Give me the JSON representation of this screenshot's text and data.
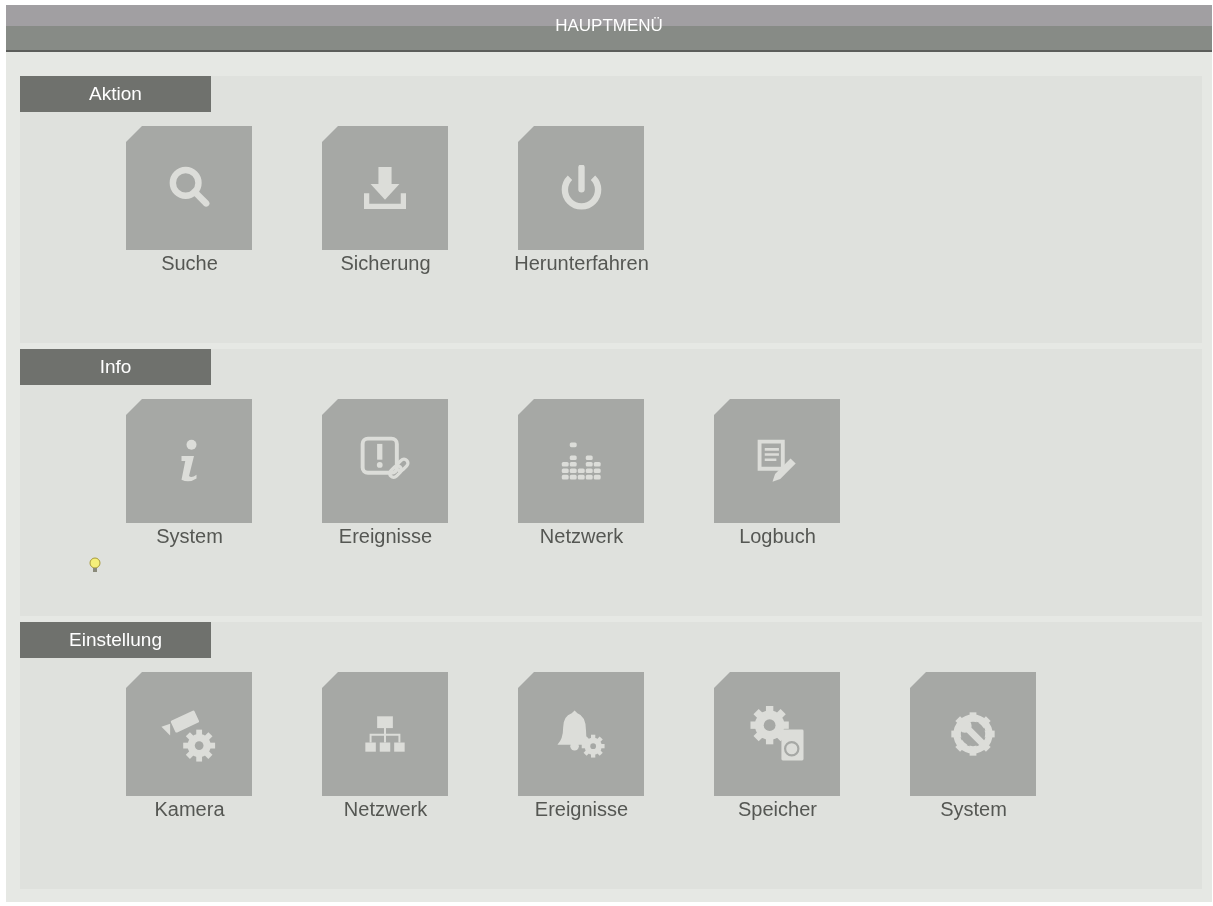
{
  "window": {
    "title": "HAUPTMENÜ"
  },
  "sections": [
    {
      "title": "Aktion",
      "hint": false,
      "tiles": [
        {
          "label": "Suche",
          "kind": "search"
        },
        {
          "label": "Sicherung",
          "kind": "download"
        },
        {
          "label": "Herunterfahren",
          "kind": "power"
        }
      ]
    },
    {
      "title": "Info",
      "hint": true,
      "tiles": [
        {
          "label": "System",
          "kind": "info"
        },
        {
          "label": "Ereignisse",
          "kind": "alert"
        },
        {
          "label": "Netzwerk",
          "kind": "bars"
        },
        {
          "label": "Logbuch",
          "kind": "log"
        }
      ]
    },
    {
      "title": "Einstellung",
      "hint": false,
      "tiles": [
        {
          "label": "Kamera",
          "kind": "camera"
        },
        {
          "label": "Netzwerk",
          "kind": "network"
        },
        {
          "label": "Ereignisse",
          "kind": "bell"
        },
        {
          "label": "Speicher",
          "kind": "storage"
        },
        {
          "label": "System",
          "kind": "wrench"
        }
      ]
    }
  ]
}
